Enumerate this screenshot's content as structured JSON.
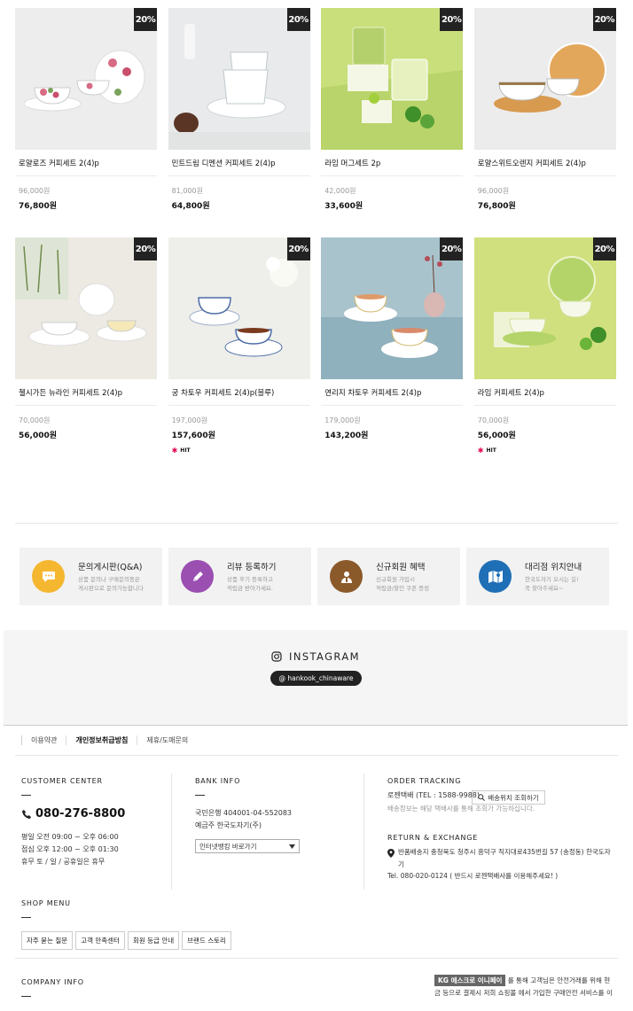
{
  "products_row1": [
    {
      "name": "로얄로즈 커피세트 2(4)p",
      "price_old": "96,000원",
      "price_new": "76,800원",
      "badge": "20%",
      "hit": false,
      "bg": "#ededed"
    },
    {
      "name": "민트드림 디멘션 커피세트 2(4)p",
      "price_old": "81,000원",
      "price_new": "64,800원",
      "badge": "20%",
      "hit": false,
      "bg": "#e8eaeb"
    },
    {
      "name": "라임 머그세트 2p",
      "price_old": "42,000원",
      "price_new": "33,600원",
      "badge": "20%",
      "hit": false,
      "bg": "#c9df7c"
    },
    {
      "name": "로얄스위트오렌지 커피세트 2(4)p",
      "price_old": "96,000원",
      "price_new": "76,800원",
      "badge": "20%",
      "hit": false,
      "bg": "#ececec"
    }
  ],
  "products_row2": [
    {
      "name": "첼시가든 뉴라인 커피세트 2(4)p",
      "price_old": "70,000원",
      "price_new": "56,000원",
      "badge": "20%",
      "hit": false,
      "bg": "#eceae3"
    },
    {
      "name": "궁 차토우 커피세트 2(4)p(블루)",
      "price_old": "197,000원",
      "price_new": "157,600원",
      "badge": "20%",
      "hit": true,
      "bg": "#eeeeea"
    },
    {
      "name": "연리지 차토우 커피세트 2(4)p",
      "price_old": "179,000원",
      "price_new": "143,200원",
      "badge": "20%",
      "hit": false,
      "bg": "#a9c3cc"
    },
    {
      "name": "라임 커피세트 2(4)p",
      "price_old": "70,000원",
      "price_new": "56,000원",
      "badge": "20%",
      "hit": true,
      "bg": "#d0e07e"
    }
  ],
  "hit_label": "HIT",
  "banners": [
    {
      "title": "문의게시판(Q&A)",
      "sub1": "상품 문의나 구매문의등은",
      "sub2": "게시판으로 문의가능합니다",
      "color": "#f5b730",
      "icon": "chat-icon"
    },
    {
      "title": "리뷰 등록하기",
      "sub1": "상품 후기 등록하고",
      "sub2": "적립금 받아가세요.",
      "color": "#9a4fb1",
      "icon": "pencil-icon"
    },
    {
      "title": "신규회원 혜택",
      "sub1": "신규회원 가입시",
      "sub2": "적립금/할인 쿠폰 증정",
      "color": "#8b5a2b",
      "icon": "member-icon"
    },
    {
      "title": "대리점 위치안내",
      "sub1": "한국도자기 오시는 길!",
      "sub2": "꼭 찾아주세요~",
      "color": "#1f6fb7",
      "icon": "map-icon"
    }
  ],
  "instagram": {
    "title": "INSTAGRAM",
    "handle": "@ hankook_chinaware"
  },
  "footer_links": [
    "이용약관",
    "개인정보취급방침",
    "제휴/도매문의"
  ],
  "customer_center": {
    "title": "CUSTOMER CENTER",
    "phone": "080-276-8800",
    "hours": [
      "평일  오전 09:00 ~ 오후 06:00",
      "점심  오후 12:00 ~ 오후 01:30",
      "휴무  토 / 일 / 공휴일은 휴무"
    ]
  },
  "bank_info": {
    "title": "BANK INFO",
    "account": "국민은행 404001-04-552083",
    "holder": "예금주 한국도자기(주)",
    "select": "인터넷뱅킹 바로가기"
  },
  "order_tracking": {
    "title": "ORDER TRACKING",
    "carrier": "로젠택배 (TEL : 1588-9988)",
    "button": "배송위치 조회하기",
    "note": "배송정보는 해당 택배사를 통해 조회가 가능하십니다."
  },
  "return_exchange": {
    "title": "RETURN & EXCHANGE",
    "address": "반품배송지  충청북도 청주시 흥덕구 직지대로435번길 57 (송정동) 한국도자",
    "address2": "기",
    "tel": "Tel. 080-020-0124 ( 반드시 로젠택배사를 이용해주세요! )"
  },
  "shop_menu": {
    "title": "SHOP MENU",
    "items": [
      "자주 묻는 질문",
      "고객 만족센터",
      "회원 등급 안내",
      "브랜드 스토리"
    ]
  },
  "company_info": {
    "title": "COMPANY INFO"
  },
  "kg": {
    "badge": "KG 에스크로 이니페이",
    "line1": " 를 통해 고객님은 안전거래를 위해 현",
    "line2": "금 등으로 결제시 저희 쇼핑몰 에서 가입한 구매안전 서비스를 이"
  }
}
